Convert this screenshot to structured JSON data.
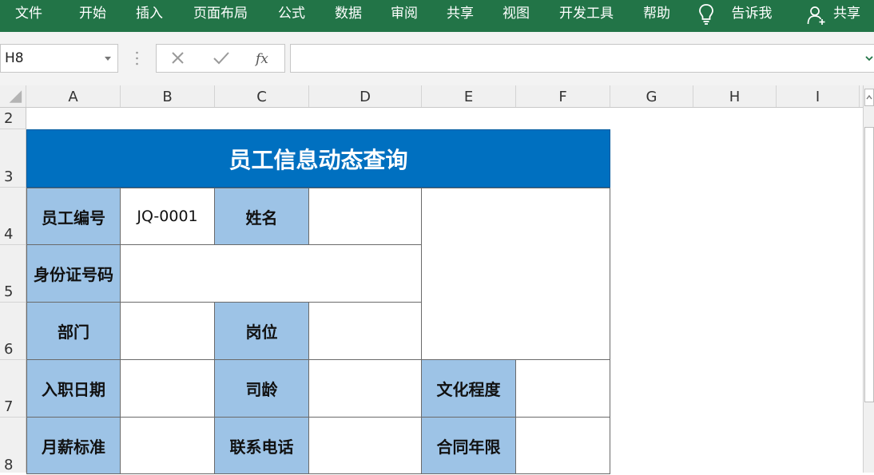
{
  "ribbon": {
    "tabs": [
      {
        "label": "文件",
        "name": "file"
      },
      {
        "label": "开始",
        "name": "home"
      },
      {
        "label": "插入",
        "name": "insert"
      },
      {
        "label": "页面布局",
        "name": "page-layout"
      },
      {
        "label": "公式",
        "name": "formulas"
      },
      {
        "label": "数据",
        "name": "data"
      },
      {
        "label": "审阅",
        "name": "review"
      },
      {
        "label": "共享",
        "name": "share-tab"
      },
      {
        "label": "视图",
        "name": "view"
      },
      {
        "label": "开发工具",
        "name": "developer"
      },
      {
        "label": "帮助",
        "name": "help"
      }
    ],
    "tell_me": "告诉我",
    "share": "共享",
    "icons": {
      "tell_me": "lightbulb-icon",
      "share": "person-icon"
    },
    "color": "#227447"
  },
  "formula_bar": {
    "name_box": "H8",
    "formula": "",
    "icons": {
      "cancel": "x-icon",
      "enter": "checkmark-icon",
      "function": "fx-icon",
      "expand": "chevron-down-icon"
    }
  },
  "columns": [
    "A",
    "B",
    "C",
    "D",
    "E",
    "F",
    "G",
    "H",
    "I"
  ],
  "rows": [
    "2",
    "3",
    "4",
    "5",
    "6",
    "7",
    "8"
  ],
  "table": {
    "title": "员工信息动态查询",
    "labels": {
      "emp_no": "员工编号",
      "name": "姓名",
      "id_no": "身份证号码",
      "dept": "部门",
      "position": "岗位",
      "hire_date": "入职日期",
      "tenure": "司龄",
      "education": "文化程度",
      "salary": "月薪标准",
      "phone": "联系电话",
      "contract": "合同年限"
    },
    "values": {
      "emp_no": "JQ-0001",
      "name": "",
      "id_no": "",
      "dept": "",
      "position": "",
      "hire_date": "",
      "tenure": "",
      "education": "",
      "salary": "",
      "phone": "",
      "contract": ""
    },
    "colors": {
      "header": "#0070c0",
      "label": "#9dc3e6"
    }
  }
}
